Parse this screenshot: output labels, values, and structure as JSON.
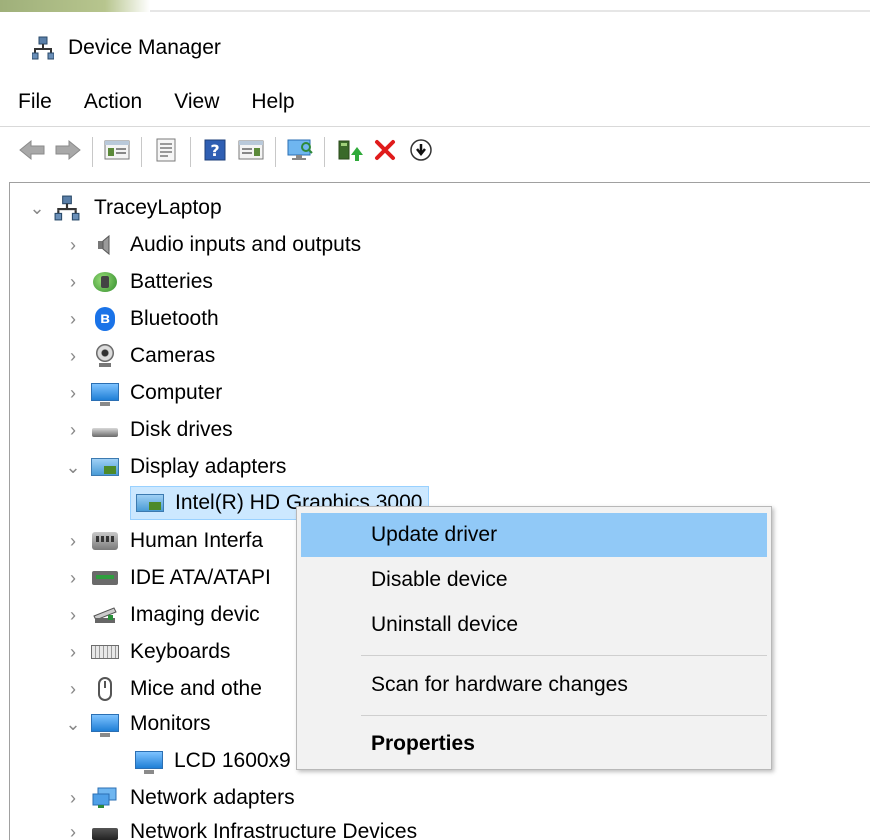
{
  "window": {
    "title": "Device Manager"
  },
  "menubar": {
    "items": [
      "File",
      "Action",
      "View",
      "Help"
    ]
  },
  "toolbar": {
    "buttons": [
      {
        "name": "back-arrow-icon"
      },
      {
        "name": "forward-arrow-icon"
      },
      {
        "name": "show-hide-console-tree-icon"
      },
      {
        "name": "properties-icon"
      },
      {
        "name": "help-icon"
      },
      {
        "name": "action-pane-icon"
      },
      {
        "name": "scan-hardware-icon"
      },
      {
        "name": "update-driver-icon"
      },
      {
        "name": "uninstall-device-icon"
      },
      {
        "name": "disable-device-icon"
      }
    ]
  },
  "tree": {
    "root": "TraceyLaptop",
    "categories": [
      {
        "label": "Audio inputs and outputs",
        "expanded": false
      },
      {
        "label": "Batteries",
        "expanded": false
      },
      {
        "label": "Bluetooth",
        "expanded": false
      },
      {
        "label": "Cameras",
        "expanded": false
      },
      {
        "label": "Computer",
        "expanded": false
      },
      {
        "label": "Disk drives",
        "expanded": false
      },
      {
        "label": "Display adapters",
        "expanded": true
      },
      {
        "label": "Intel(R) HD Graphics 3000",
        "child": true
      },
      {
        "label": "Human Interfa",
        "expanded": false
      },
      {
        "label": "IDE ATA/ATAPI",
        "expanded": false
      },
      {
        "label": "Imaging devic",
        "expanded": false
      },
      {
        "label": "Keyboards",
        "expanded": false
      },
      {
        "label": "Mice and othe",
        "expanded": false
      },
      {
        "label": "Monitors",
        "expanded": true
      },
      {
        "label": "LCD 1600x9",
        "child": true
      },
      {
        "label": "Network adapters",
        "expanded": false
      },
      {
        "label": "Network Infrastructure Devices",
        "expanded": false
      }
    ]
  },
  "context_menu": {
    "items": [
      {
        "label": "Update driver",
        "highlighted": true
      },
      {
        "label": "Disable device"
      },
      {
        "label": "Uninstall device"
      },
      {
        "label": "Scan for hardware changes"
      },
      {
        "label": "Properties",
        "bold": true
      }
    ]
  },
  "colors": {
    "selection": "#cce8ff",
    "menu_highlight": "#91c9f7",
    "uninstall_red": "#e01b1b"
  }
}
